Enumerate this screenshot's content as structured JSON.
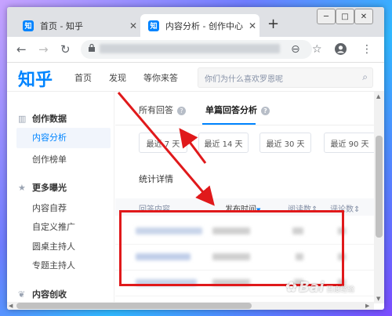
{
  "browser": {
    "tabs": [
      {
        "favicon": "知",
        "title": "首页 - 知乎",
        "active": false
      },
      {
        "favicon": "知",
        "title": "内容分析 - 创作中心",
        "active": true
      }
    ],
    "new_tab": "+",
    "window_controls": [
      "─",
      "□",
      "✕"
    ]
  },
  "site": {
    "logo": "知乎",
    "nav": [
      "首页",
      "发现",
      "等你来答"
    ],
    "search_placeholder": "你们为什么喜欢罗恩呢"
  },
  "sidebar": {
    "sections": [
      {
        "title": "创作数据",
        "icon": "bar-chart-icon",
        "items": [
          "内容分析",
          "创作榜单"
        ],
        "active": "内容分析"
      },
      {
        "title": "更多曝光",
        "icon": "star-icon",
        "items": [
          "内容自荐",
          "自定义推广",
          "圆桌主持人",
          "专题主持人"
        ]
      },
      {
        "title": "内容创收",
        "icon": "leaf-icon",
        "items": []
      }
    ]
  },
  "main": {
    "tabs": [
      {
        "label": "所有回答",
        "active": false
      },
      {
        "label": "单篇回答分析",
        "active": true
      }
    ],
    "ranges": [
      "最近 7 天",
      "最近 14 天",
      "最近 30 天",
      "最近 90 天"
    ],
    "stats_title": "统计详情",
    "table_headers": [
      "回答内容",
      "发布时间",
      "阅读数",
      "评论数"
    ],
    "sort_marker": "▼",
    "header_suffix": "⇕"
  },
  "watermark": {
    "text": "Bai",
    "suffix": "百度经验"
  },
  "colors": {
    "accent": "#0084ff",
    "annotation_red": "#e0191b"
  }
}
